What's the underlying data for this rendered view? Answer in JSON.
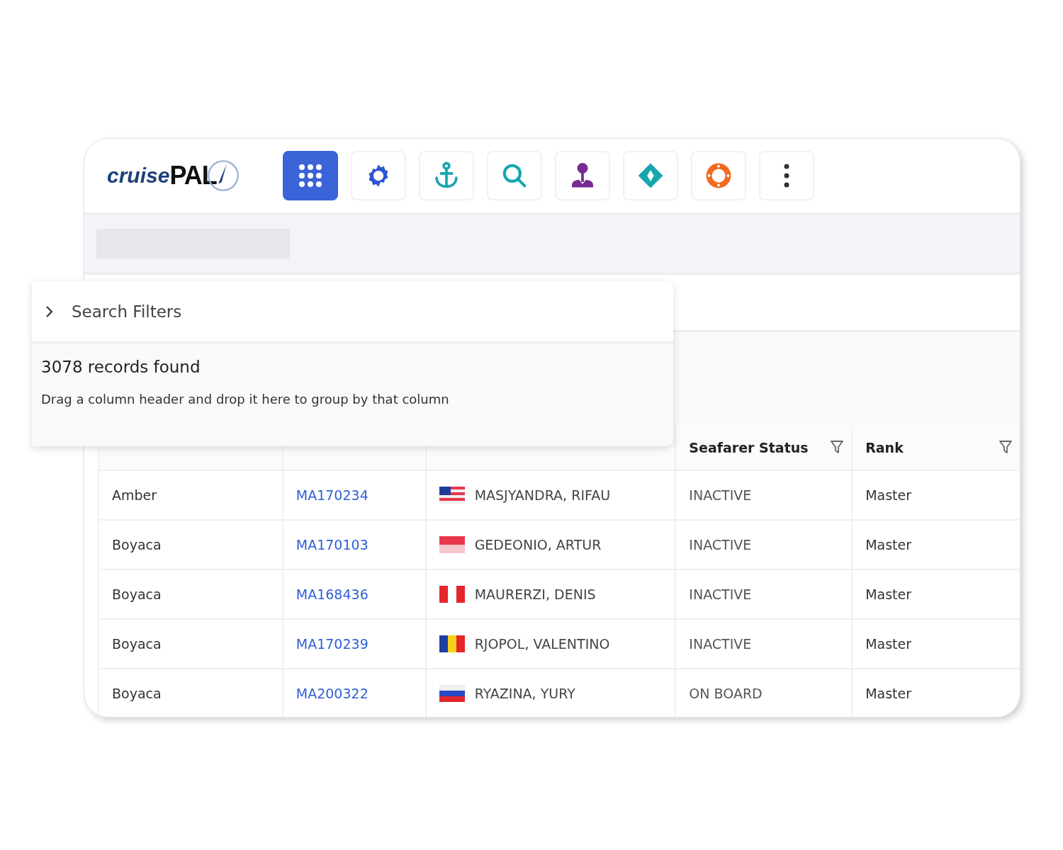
{
  "logo": {
    "word_1": "cruise",
    "word_2": "PAL"
  },
  "toolbar": [
    {
      "kind": "grid",
      "selected": true
    },
    {
      "kind": "gear",
      "selected": false
    },
    {
      "kind": "anchor",
      "selected": false
    },
    {
      "kind": "search",
      "selected": false
    },
    {
      "kind": "pin",
      "selected": false
    },
    {
      "kind": "diamond",
      "selected": false
    },
    {
      "kind": "lifebuoy",
      "selected": false
    },
    {
      "kind": "more",
      "selected": false
    }
  ],
  "filters": {
    "label": "Search Filters",
    "expanded": false
  },
  "records": {
    "count": "3078 records found",
    "hint": "Drag a column header and drop it here to group by that column"
  },
  "table": {
    "columns": [
      {
        "label": "Seafarer Status"
      },
      {
        "label": "Rank"
      }
    ],
    "rows": [
      {
        "vessel": "Amber",
        "emp_no": "MA170234",
        "flag": {
          "kind": "canton",
          "stripes": [
            {
              "color": "#e8374a"
            },
            {
              "color": "#eeeeee"
            },
            {
              "color": "#1f3b9a"
            }
          ]
        },
        "name": "MASJYANDRA, RIFAU",
        "status": "INACTIVE",
        "rank": "Master"
      },
      {
        "vessel": "Boyaca",
        "emp_no": "MA170103",
        "flag": {
          "kind": "horizontal",
          "stripes": [
            {
              "color": "#e8374a"
            },
            {
              "color": "#f7c5cc"
            }
          ]
        },
        "name": "GEDEONIO, ARTUR",
        "status": "INACTIVE",
        "rank": "Master"
      },
      {
        "vessel": "Boyaca",
        "emp_no": "MA168436",
        "flag": {
          "kind": "vertical",
          "stripes": [
            {
              "color": "#e5262a"
            },
            {
              "color": "#ffffff"
            },
            {
              "color": "#e5262a"
            }
          ]
        },
        "name": "MAURERZI, DENIS",
        "status": "INACTIVE",
        "rank": "Master"
      },
      {
        "vessel": "Boyaca",
        "emp_no": "MA170239",
        "flag": {
          "kind": "vertical",
          "stripes": [
            {
              "color": "#1d3fa0"
            },
            {
              "color": "#f6d21c"
            },
            {
              "color": "#e5262a"
            }
          ]
        },
        "name": "RJOPOL, VALENTINO",
        "status": "INACTIVE",
        "rank": "Master"
      },
      {
        "vessel": "Boyaca",
        "emp_no": "MA200322",
        "flag": {
          "kind": "horizontal",
          "stripes": [
            {
              "color": "#eeeeee"
            },
            {
              "color": "#2a49c4"
            },
            {
              "color": "#e5262a"
            }
          ]
        },
        "name": "RYAZINA, YURY",
        "status": "ON BOARD",
        "rank": "Master"
      }
    ]
  }
}
